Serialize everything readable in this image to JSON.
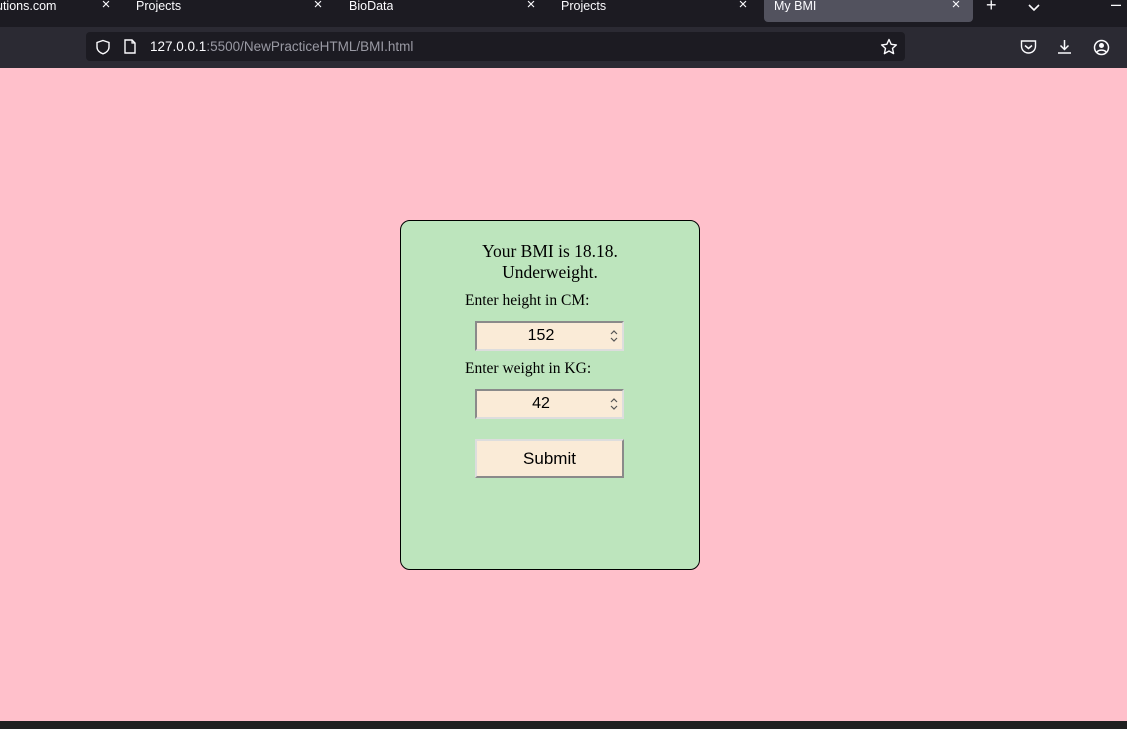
{
  "browser": {
    "tabs": [
      {
        "label": "utions.com"
      },
      {
        "label": "Projects"
      },
      {
        "label": "BioData"
      },
      {
        "label": "Projects"
      },
      {
        "label": "My BMI",
        "active": true
      }
    ],
    "new_tab_icon": "plus-icon",
    "tab_list_icon": "chevron-down-icon",
    "minimize_icon": "minimize-icon",
    "url_host": "127.0.0.1",
    "url_path": ":5500/NewPracticeHTML/BMI.html",
    "icons": [
      "shield-icon",
      "page-icon",
      "star-icon",
      "pocket-icon",
      "download-icon",
      "account-icon"
    ]
  },
  "page": {
    "background_color": "#ffc0cb",
    "card_color": "#bde5bd",
    "input_color": "#faebd7",
    "result_line1": "Your BMI is 18.18.",
    "result_line2": "Underweight.",
    "height_label": "Enter height in CM:",
    "height_value": "152",
    "weight_label": "Enter weight in KG:",
    "weight_value": "42",
    "submit_label": "Submit"
  }
}
